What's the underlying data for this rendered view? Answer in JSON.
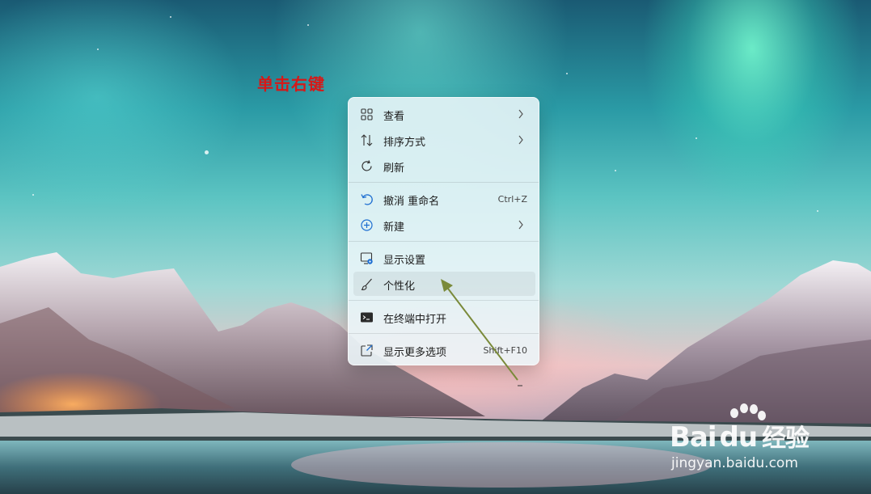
{
  "annotation": {
    "text": "单击右键"
  },
  "context_menu": {
    "items": [
      {
        "label": "查看",
        "shortcut": "",
        "submenu": true,
        "icon": "grid-view-icon"
      },
      {
        "label": "排序方式",
        "shortcut": "",
        "submenu": true,
        "icon": "sort-icon"
      },
      {
        "label": "刷新",
        "shortcut": "",
        "submenu": false,
        "icon": "refresh-icon"
      },
      {
        "label": "撤消 重命名",
        "shortcut": "Ctrl+Z",
        "submenu": false,
        "icon": "undo-icon"
      },
      {
        "label": "新建",
        "shortcut": "",
        "submenu": true,
        "icon": "new-plus-icon"
      },
      {
        "label": "显示设置",
        "shortcut": "",
        "submenu": false,
        "icon": "display-settings-icon"
      },
      {
        "label": "个性化",
        "shortcut": "",
        "submenu": false,
        "icon": "brush-icon",
        "highlighted": true
      },
      {
        "label": "在终端中打开",
        "shortcut": "",
        "submenu": false,
        "icon": "terminal-icon"
      },
      {
        "label": "显示更多选项",
        "shortcut": "Shift+F10",
        "submenu": false,
        "icon": "more-options-icon"
      }
    ]
  },
  "colors": {
    "annotation": "#d61818",
    "arrow": "#7a8a3a",
    "accent_blue": "#1f6fd1"
  },
  "watermark": {
    "brand_latin": "Bai",
    "brand_latin_2": "du",
    "brand_cn": "经验",
    "url": "jingyan.baidu.com"
  }
}
